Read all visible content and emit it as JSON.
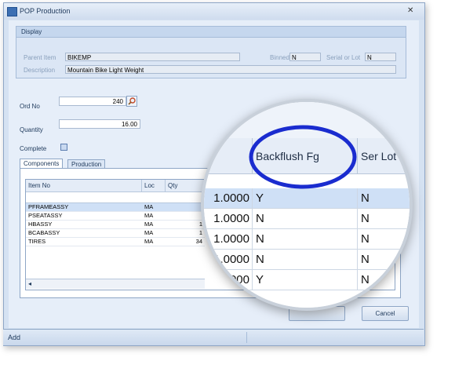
{
  "window": {
    "title": "POP Production"
  },
  "display": {
    "header": "Display",
    "parent_item_label": "Parent Item",
    "parent_item_value": "BIKEMP",
    "binned_label": "Binned",
    "binned_value": "N",
    "serial_lot_label": "Serial or Lot",
    "serial_lot_value": "N",
    "description_label": "Description",
    "description_value": "Mountain Bike Light Weight"
  },
  "form": {
    "ord_no_label": "Ord No",
    "ord_no_value": "240",
    "quantity_label": "Quantity",
    "quantity_value": "16.00",
    "complete_label": "Complete"
  },
  "tabs": [
    {
      "label": "Components"
    },
    {
      "label": "Production"
    }
  ],
  "grid": {
    "columns": [
      "Item No",
      "Loc",
      "Qty"
    ],
    "rows": [
      {
        "item": "PFRAMEASSY",
        "loc": "MA",
        "qty": ""
      },
      {
        "item": "PSEATASSY",
        "loc": "MA",
        "qty": ""
      },
      {
        "item": "HBASSY",
        "loc": "MA",
        "qty": "1"
      },
      {
        "item": "BCABASSY",
        "loc": "MA",
        "qty": "1"
      },
      {
        "item": "TIRES",
        "loc": "MA",
        "qty": "34"
      }
    ]
  },
  "magnifier": {
    "columns": [
      "Backflush Fg",
      "Ser Lot"
    ],
    "rows": [
      {
        "qty": "1.0000",
        "backflush": "Y",
        "serlot": "N"
      },
      {
        "qty": "1.0000",
        "backflush": "N",
        "serlot": "N"
      },
      {
        "qty": "1.0000",
        "backflush": "N",
        "serlot": "N"
      },
      {
        "qty": "1.0000",
        "backflush": "N",
        "serlot": "N"
      },
      {
        "qty": "000",
        "backflush": "Y",
        "serlot": "N"
      }
    ]
  },
  "buttons": {
    "cancel": "Cancel"
  },
  "status": {
    "text": "Add"
  },
  "colors": {
    "highlight_ring": "#1a2ccf",
    "selected_row": "#cfe0f6"
  }
}
